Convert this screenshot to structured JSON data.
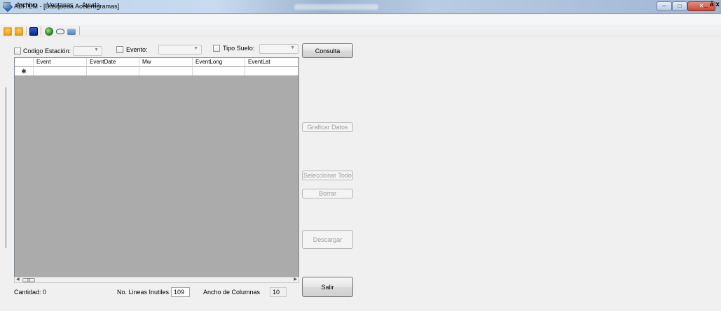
{
  "window": {
    "title": "ADITEM - [Busqueda Acelerogramas]",
    "controls": {
      "minimize": "─",
      "maximize": "□",
      "close": "✕"
    },
    "mdi_controls": "_ ȧ x"
  },
  "menu": {
    "items": [
      "Archivo",
      "Ventanas",
      "Ayuda"
    ]
  },
  "toolbar": {
    "icons": [
      "house-icon",
      "house-up-icon",
      "chart-icon",
      "globe-icon",
      "glasses-icon",
      "folder-icon"
    ]
  },
  "filters": {
    "codigo_label": "Codigo Estación:",
    "codigo_value": "",
    "evento_label": "Evento:",
    "evento_value": "",
    "tipo_suelo_label": "Tipo Suelo:",
    "tipo_suelo_value": "",
    "consulta_button": "Consulta"
  },
  "grid": {
    "columns": [
      "Event",
      "EventDate",
      "Mw",
      "EventLong",
      "EventLat"
    ],
    "new_row_marker": "✱",
    "rows": []
  },
  "side_buttons": {
    "graficar": "Graficar Datos",
    "seleccionar_todo": "Seleccionar Todo",
    "borrar": "Borrar",
    "descargar": "Descargar",
    "salir": "Salir"
  },
  "footer": {
    "cantidad_label": "Cantidad: 0",
    "lineas_label": "No. Lineas Inutiles",
    "lineas_value": "109",
    "ancho_label": "Ancho de Columnas",
    "ancho_value": "10"
  },
  "colors": {
    "grid_background": "#ababab",
    "form_background": "#f0f0f0",
    "close_button": "#c44a35"
  }
}
